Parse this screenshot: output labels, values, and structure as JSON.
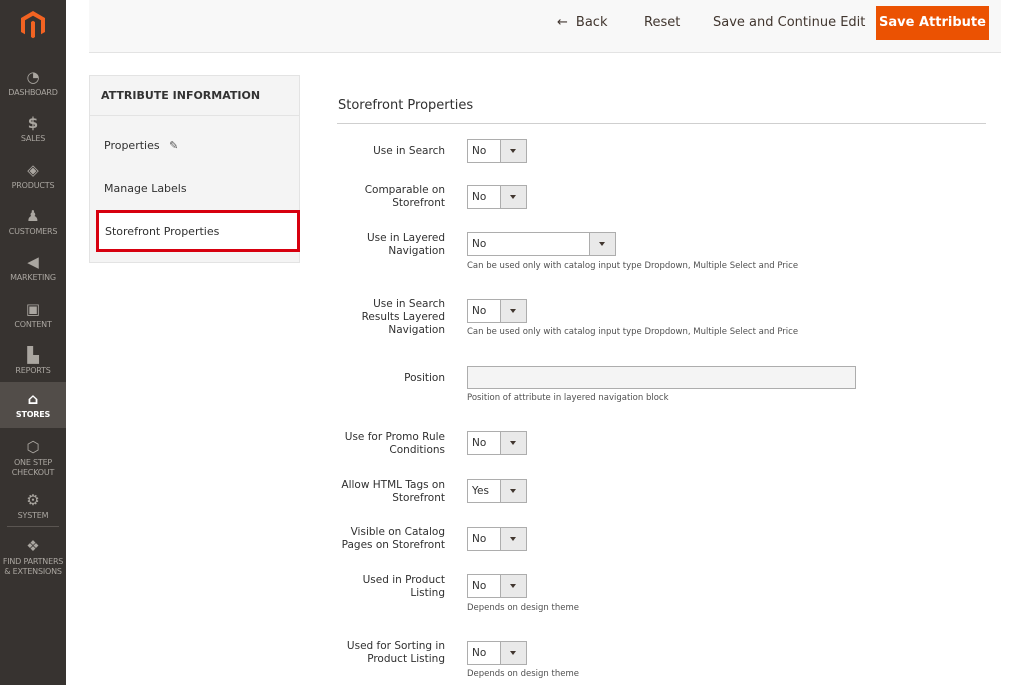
{
  "nav": {
    "items": [
      {
        "label": "DASHBOARD",
        "icon": "dashboard-icon"
      },
      {
        "label": "SALES",
        "icon": "dollar-icon"
      },
      {
        "label": "PRODUCTS",
        "icon": "cube-icon"
      },
      {
        "label": "CUSTOMERS",
        "icon": "person-icon"
      },
      {
        "label": "MARKETING",
        "icon": "megaphone-icon"
      },
      {
        "label": "CONTENT",
        "icon": "layout-icon"
      },
      {
        "label": "REPORTS",
        "icon": "bar-chart-icon"
      },
      {
        "label": "STORES",
        "icon": "store-icon"
      },
      {
        "label_1": "ONE STEP",
        "label_2": "CHECKOUT",
        "icon": "hexagon-icon"
      },
      {
        "label": "SYSTEM",
        "icon": "gear-icon"
      },
      {
        "label_1": "FIND PARTNERS",
        "label_2": "& EXTENSIONS",
        "icon": "boxes-icon"
      }
    ],
    "active": "STORES"
  },
  "header": {
    "back_label": "Back",
    "reset_label": "Reset",
    "save_continue_label": "Save and Continue Edit",
    "save_label": "Save Attribute"
  },
  "tabs": {
    "title": "ATTRIBUTE INFORMATION",
    "items": [
      "Properties",
      "Manage Labels",
      "Storefront Properties"
    ],
    "active": "Storefront Properties"
  },
  "form": {
    "section_title": "Storefront Properties",
    "fields": [
      {
        "label_1": "Use in Search",
        "value": "No"
      },
      {
        "label_1": "Comparable on",
        "label_2": "Storefront",
        "value": "No"
      },
      {
        "label_1": "Use in Layered",
        "label_2": "Navigation",
        "value": "No",
        "note": "Can be used only with catalog input type Dropdown, Multiple Select and Price"
      },
      {
        "label_1": "Use in Search",
        "label_2": "Results Layered",
        "label_3": "Navigation",
        "value": "No",
        "note": "Can be used only with catalog input type Dropdown, Multiple Select and Price"
      },
      {
        "label_1": "Position",
        "value": "",
        "note": "Position of attribute in layered navigation block"
      },
      {
        "label_1": "Use for Promo Rule",
        "label_2": "Conditions",
        "value": "No"
      },
      {
        "label_1": "Allow HTML Tags on",
        "label_2": "Storefront",
        "value": "Yes"
      },
      {
        "label_1": "Visible on Catalog",
        "label_2": "Pages on Storefront",
        "value": "No"
      },
      {
        "label_1": "Used in Product",
        "label_2": "Listing",
        "value": "No",
        "note": "Depends on design theme"
      },
      {
        "label_1": "Used for Sorting in",
        "label_2": "Product Listing",
        "value": "No",
        "note": "Depends on design theme"
      }
    ]
  },
  "colors": {
    "nav_bg": "#373330",
    "accent": "#eb5202",
    "highlight": "#d7000f"
  }
}
